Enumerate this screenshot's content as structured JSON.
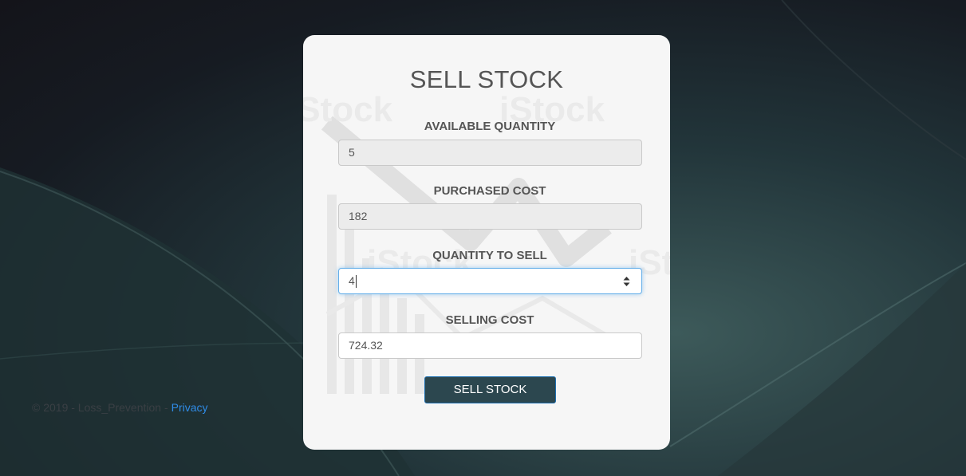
{
  "form": {
    "title": "SELL STOCK",
    "fields": [
      {
        "label": "AVAILABLE QUANTITY",
        "value": "5",
        "readonly": true
      },
      {
        "label": "PURCHASED COST",
        "value": "182",
        "readonly": true
      },
      {
        "label": "QUANTITY TO SELL",
        "value": "4",
        "readonly": false,
        "focused": true
      },
      {
        "label": "SELLING COST",
        "value": "724.32",
        "readonly": false
      }
    ],
    "submit_label": "SELL STOCK"
  },
  "footer": {
    "copyright": "© 2019 - Loss_Prevention -",
    "privacy_label": "Privacy"
  },
  "watermark_text": "iStock",
  "colors": {
    "button_bg": "#2c474f",
    "link": "#2f8be6",
    "focus_border": "#66afe9"
  }
}
